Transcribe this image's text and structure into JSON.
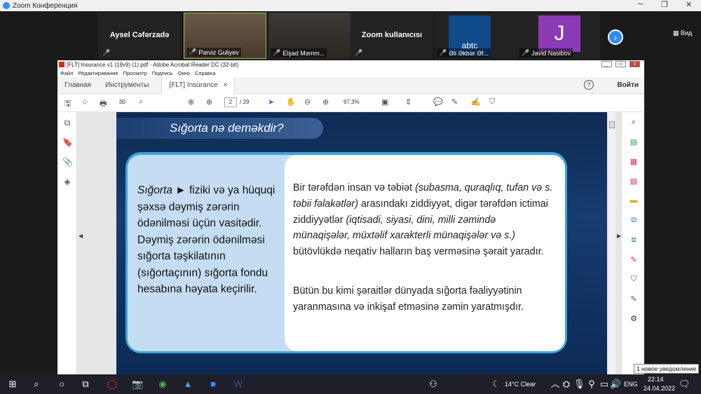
{
  "zoom": {
    "title": "Zoom Конференция",
    "view_label": "Вид",
    "participants": [
      {
        "display": "Aysel Cəfərzadə",
        "caption": ""
      },
      {
        "display": "",
        "caption": "Pərviz Guliyev"
      },
      {
        "display": "",
        "caption": "Elşad Məmm..."
      },
      {
        "display": "Zoom kullanıcısı",
        "caption": ""
      },
      {
        "display": "abtc",
        "caption": "Əli Əkbər Əf..."
      },
      {
        "display": "J",
        "caption": "Javid Nasibov"
      }
    ]
  },
  "acrobat": {
    "title": "[FLT] Insurance v1 (19x9) (1).pdf - Adobe Acrobat Reader DC (32-bit)",
    "menu": [
      "Файл",
      "Редактирование",
      "Просмотр",
      "Подпись",
      "Окно",
      "Справка"
    ],
    "tabs": {
      "home": "Главная",
      "tools": "Инструменты",
      "doc": "[FLT] Insurance v1 (...",
      "close": "×"
    },
    "signin": "Войти",
    "help": "?",
    "page_current": "2",
    "page_total": "/ 29",
    "zoom": "97,3%"
  },
  "slide": {
    "title": "Sığorta nə deməkdir?",
    "left": {
      "italic": "Sığorta",
      "rest": " ► fiziki və ya hüquqi şəxsə dəymiş zərərin ödənilməsi üçün vasitədir. Dəymiş zərərin ödənilməsi sığorta təşkilatının (sığortaçının) sığorta fondu hesabına həyata keçirilir."
    },
    "right1": {
      "a": "Bir tərəfdən insan və təbiət ",
      "b": "(subasma, quraqlıq, tufan və s. təbii fəlakətlər)",
      "c": " arasındakı ziddiyyət, digər tərəfdən ictimai ziddiyyətlər ",
      "d": "(iqtisadi, siyasi, dini, milli zəmində münaqişələr, müxtəlif xarakterli münaqişələr və s.)",
      "e": " bütövlükdə neqativ halların baş verməsinə şərait yaradır."
    },
    "right2": "Bütün bu kimi şəraitlər dünyada sığorta fəaliyyətinin yaranmasına və inkişaf etməsinə zəmin yaratmışdır."
  },
  "notification": "1 новое уведомление",
  "taskbar": {
    "weather": "14°C  Clear",
    "lang": "ENG",
    "time": "22:14",
    "date": "24.04.2022"
  }
}
